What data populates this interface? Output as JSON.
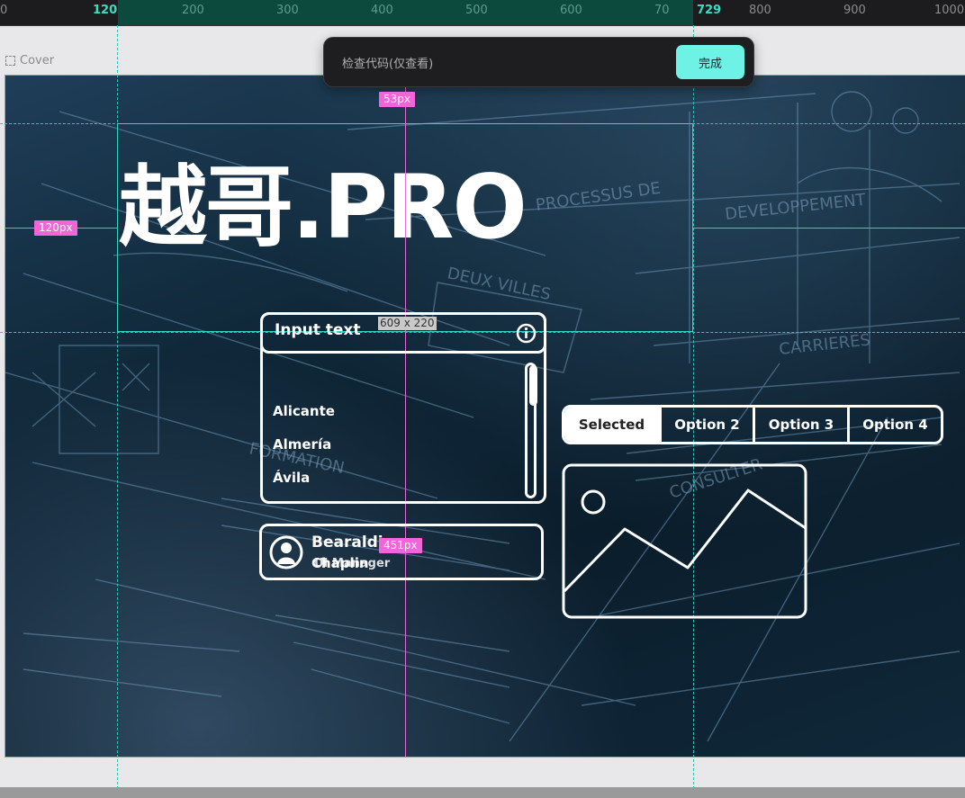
{
  "ruler": {
    "labels": [
      "0",
      "120",
      "200",
      "300",
      "400",
      "500",
      "600",
      "70",
      "729",
      "800",
      "900",
      "1000"
    ]
  },
  "toast": {
    "text": "检查代码(仅查看)",
    "done_label": "完成"
  },
  "canvas": {
    "frame_label": "Cover",
    "measures": {
      "top_gap": "53px",
      "left_gap": "120px",
      "selection_size": "609 x 220",
      "bottom_gap": "451px"
    }
  },
  "hero": {
    "title": "越哥.PRO"
  },
  "list_widget": {
    "title": "Input text",
    "items": [
      "Alicante",
      "Almería",
      "Ávila"
    ]
  },
  "profile": {
    "name": "Bearaldi",
    "subtitle": "Chaplin",
    "role": "UI Manager"
  },
  "segmented": {
    "options": [
      "Selected",
      "Option 2",
      "Option 3",
      "Option 4"
    ],
    "selected_index": 0
  },
  "icons": {
    "info": "info-circle-icon",
    "avatar": "user-avatar-icon",
    "image": "image-placeholder-icon",
    "frame": "frame-icon"
  },
  "colors": {
    "accent": "#6ff2e6",
    "guide": "#2cd9c5",
    "measure": "#f065d7",
    "ruler_selection": "#0d4a3e"
  }
}
